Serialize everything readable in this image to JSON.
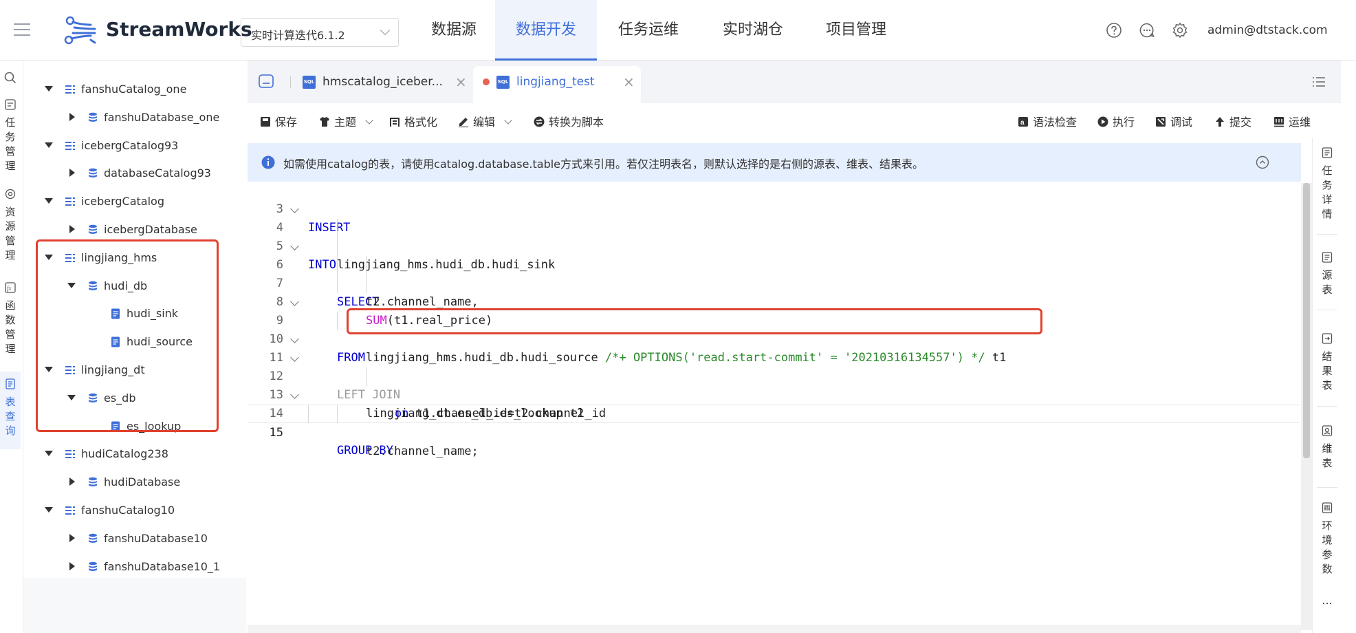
{
  "app": {
    "logo_text": "StreamWorks",
    "version": "实时计算迭代6.1.2",
    "user": "admin@dtstack.com"
  },
  "nav": [
    {
      "label": "数据源"
    },
    {
      "label": "数据开发"
    },
    {
      "label": "任务运维"
    },
    {
      "label": "实时湖仓"
    },
    {
      "label": "项目管理"
    }
  ],
  "rail": [
    {
      "label": "任务管理"
    },
    {
      "label": "资源管理"
    },
    {
      "label": "函数管理"
    },
    {
      "label": "表查询"
    }
  ],
  "tree": [
    {
      "label": "fanshuCatalog_one",
      "kind": "catalog",
      "expanded": true
    },
    {
      "label": "fanshuDatabase_one",
      "kind": "database",
      "expanded": false
    },
    {
      "label": "icebergCatalog93",
      "kind": "catalog",
      "expanded": true
    },
    {
      "label": "databaseCatalog93",
      "kind": "database",
      "expanded": false
    },
    {
      "label": "icebergCatalog",
      "kind": "catalog",
      "expanded": true
    },
    {
      "label": "icebergDatabase",
      "kind": "database",
      "expanded": false
    },
    {
      "label": "lingjiang_hms",
      "kind": "catalog",
      "expanded": true
    },
    {
      "label": "hudi_db",
      "kind": "database",
      "expanded": true
    },
    {
      "label": "hudi_sink",
      "kind": "table"
    },
    {
      "label": "hudi_source",
      "kind": "table"
    },
    {
      "label": "lingjiang_dt",
      "kind": "catalog",
      "expanded": true
    },
    {
      "label": "es_db",
      "kind": "database",
      "expanded": true
    },
    {
      "label": "es_lookup",
      "kind": "table"
    },
    {
      "label": "hudiCatalog238",
      "kind": "catalog",
      "expanded": true
    },
    {
      "label": "hudiDatabase",
      "kind": "database",
      "expanded": false
    },
    {
      "label": "fanshuCatalog10",
      "kind": "catalog",
      "expanded": true
    },
    {
      "label": "fanshuDatabase10",
      "kind": "database",
      "expanded": false
    },
    {
      "label": "fanshuDatabase10_1",
      "kind": "database",
      "expanded": false
    }
  ],
  "tabs": [
    {
      "label": "hmscatalog_iceber...",
      "badge": "SQL"
    },
    {
      "label": "lingjiang_test",
      "badge": "SQL"
    }
  ],
  "toolbar": {
    "save": "保存",
    "theme": "主题",
    "format": "格式化",
    "edit": "编辑",
    "to_script": "转换为脚本",
    "syntax_check": "语法检查",
    "run": "执行",
    "debug": "调试",
    "submit": "提交",
    "ops": "运维"
  },
  "info": "如需使用catalog的表，请使用catalog.database.table方式来引用。若仅注明表名，则默认选择的是右侧的源表、维表、结果表。",
  "code": {
    "lines": [
      {
        "n": "3",
        "text": "INSERT"
      },
      {
        "n": "4",
        "text": "INTO"
      },
      {
        "n": "5",
        "text": "lingjiang_hms.hudi_db.hudi_sink"
      },
      {
        "n": "6",
        "text": "SELECT"
      },
      {
        "n": "7",
        "text": "t2.channel_name,"
      },
      {
        "n": "8a",
        "text": "SUM"
      },
      {
        "n": "8b",
        "text": "(t1.real_price)"
      },
      {
        "n": "9",
        "text": "FROM"
      },
      {
        "n": "10a",
        "text": "lingjiang_hms.hudi_db.hudi_source "
      },
      {
        "n": "10b",
        "text": "/*+ OPTIONS('read.start-commit' = '20210316134557') */"
      },
      {
        "n": "10c",
        "text": " t1"
      },
      {
        "n": "11",
        "text": "LEFT JOIN"
      },
      {
        "n": "12",
        "text": "lingjiang_dt.es_db.es_lookup t2"
      },
      {
        "n": "13a",
        "text": "on"
      },
      {
        "n": "13b",
        "text": " t1.channel_id=t2.channel_id"
      },
      {
        "n": "14",
        "text": "GROUP BY"
      },
      {
        "n": "15",
        "text": "t2.channel_name;"
      }
    ],
    "numbers": [
      "3",
      "4",
      "5",
      "6",
      "7",
      "8",
      "9",
      "10",
      "11",
      "12",
      "13",
      "14",
      "15"
    ]
  },
  "right_panel": [
    {
      "label": "任务详情"
    },
    {
      "label": "源表"
    },
    {
      "label": "结果表"
    },
    {
      "label": "维表"
    },
    {
      "label": "环境参数"
    },
    {
      "label": "..."
    }
  ]
}
